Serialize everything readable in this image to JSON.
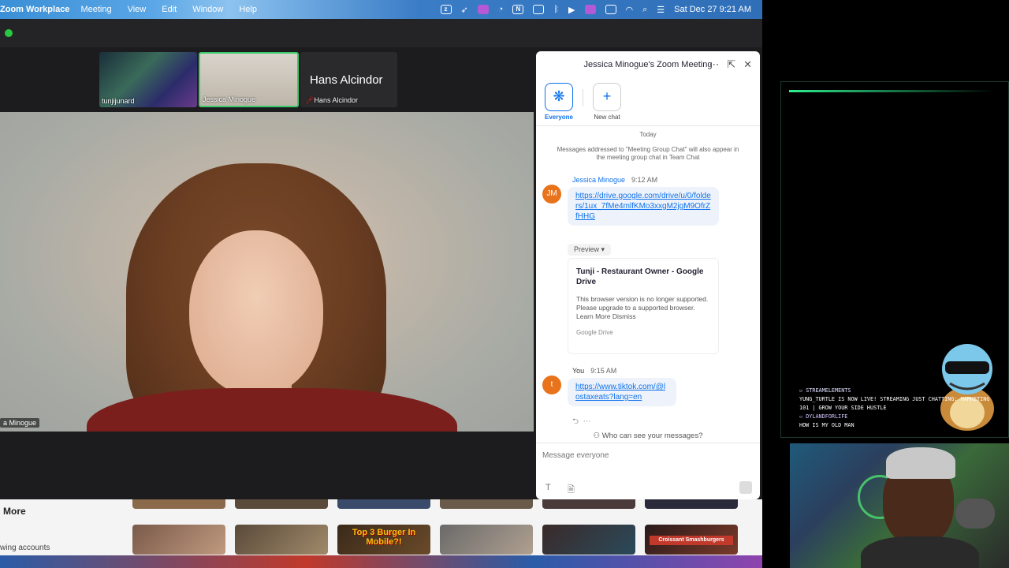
{
  "menubar": {
    "app": "Zoom Workplace",
    "items": [
      "Meeting",
      "View",
      "Edit",
      "Window",
      "Help"
    ],
    "datetime": "Sat Dec 27  9:21 AM"
  },
  "participants": {
    "tunji": "tunjijunard",
    "jessica": "Jessica Minogue",
    "hans_big": "Hans Alcindor",
    "hans_small": "Hans Alcindor"
  },
  "main_video": {
    "name": "a Minogue"
  },
  "chat": {
    "title": "Jessica Minogue's Zoom Meeting",
    "tab_everyone": "Everyone",
    "tab_newchat": "New chat",
    "today": "Today",
    "notice": "Messages addressed to \"Meeting Group Chat\" will also appear in the meeting group chat in Team Chat",
    "msg1": {
      "avatar": "JM",
      "sender": "Jessica Minogue",
      "time": "9:12 AM",
      "text": "https://drive.google.com/drive/u/0/folders/1ux_7fMe4mlfKMo3xxgM2jgM9OfrZfHHG",
      "preview_label": "Preview",
      "card_title": "Tunji - Restaurant Owner - Google Drive",
      "card_body": "This browser version is no longer supported. Please upgrade to a supported browser. Learn More Dismiss",
      "card_footer": "Google Drive"
    },
    "msg2": {
      "avatar": "t",
      "sender": "You",
      "time": "9:15 AM",
      "text": "https://www.tiktok.com/@lostaxeats?lang=en"
    },
    "who_can_see": "Who can see your messages?",
    "input_placeholder": "Message everyone"
  },
  "browser_strip": {
    "more": "More",
    "accounts": "wing accounts",
    "tile3": "Top 3 Burger In Mobile?!",
    "tile6": "Croissant Smashburgers"
  },
  "stream": {
    "chat": [
      {
        "user": "StreamElements",
        "msg": "Yung_Turtle is now live! Streaming Just Chatting: Marketing 101 | Grow Your Side Hustle"
      },
      {
        "user": "DylandForLife",
        "msg": "How is my old man"
      }
    ]
  }
}
